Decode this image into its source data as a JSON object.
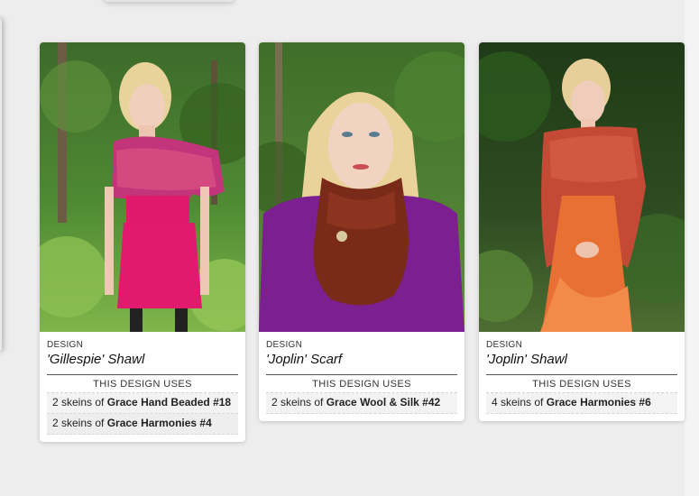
{
  "cards": [
    {
      "design_label": "DESIGN",
      "title": "'Gillespie' Shawl",
      "uses_title": "THIS DESIGN USES",
      "uses": [
        {
          "prefix": "2 skeins of ",
          "yarn": "Grace Hand Beaded #18"
        },
        {
          "prefix": "2 skeins of ",
          "yarn": "Grace Harmonies #4"
        }
      ]
    },
    {
      "design_label": "DESIGN",
      "title": "'Joplin' Scarf",
      "uses_title": "THIS DESIGN USES",
      "uses": [
        {
          "prefix": "2 skeins of ",
          "yarn": "Grace Wool & Silk #42"
        }
      ]
    },
    {
      "design_label": "DESIGN",
      "title": "'Joplin' Shawl",
      "uses_title": "THIS DESIGN USES",
      "uses": [
        {
          "prefix": "4 skeins of ",
          "yarn": "Grace Harmonies #6"
        }
      ]
    }
  ]
}
